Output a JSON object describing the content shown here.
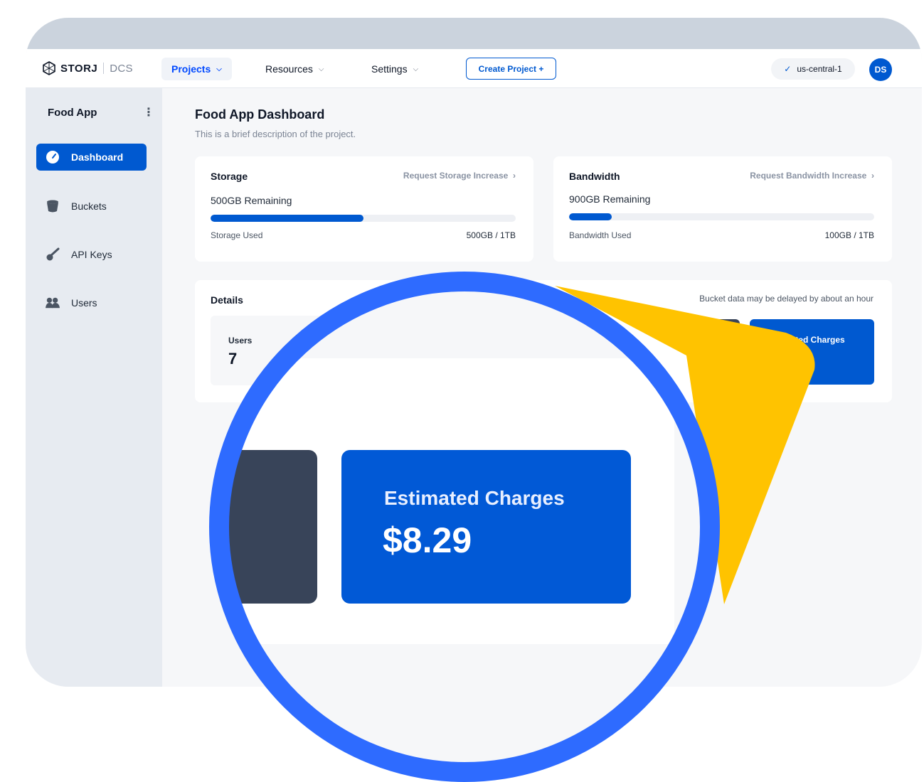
{
  "brand": {
    "name": "STORJ",
    "product": "DCS"
  },
  "topnav": {
    "items": [
      {
        "label": "Projects",
        "active": true
      },
      {
        "label": "Resources",
        "active": false
      },
      {
        "label": "Settings",
        "active": false
      }
    ],
    "create_project_label": "Create Project +",
    "region_label": "us-central-1",
    "avatar_initials": "DS"
  },
  "sidebar": {
    "project_name": "Food App",
    "items": [
      {
        "label": "Dashboard",
        "icon": "gauge-icon",
        "active": true
      },
      {
        "label": "Buckets",
        "icon": "bucket-icon",
        "active": false
      },
      {
        "label": "API Keys",
        "icon": "key-icon",
        "active": false
      },
      {
        "label": "Users",
        "icon": "users-icon",
        "active": false
      }
    ]
  },
  "page": {
    "title": "Food App Dashboard",
    "description": "This is a brief description of the project."
  },
  "storage": {
    "title": "Storage",
    "link": "Request Storage Increase",
    "remaining": "500GB Remaining",
    "used_label": "Storage Used",
    "used_value": "500GB / 1TB",
    "used_fraction": 0.5
  },
  "bandwidth": {
    "title": "Bandwidth",
    "link": "Request Bandwidth Increase",
    "remaining": "900GB Remaining",
    "used_label": "Bandwidth Used",
    "used_value": "100GB / 1TB",
    "used_fraction": 0.14
  },
  "details": {
    "title": "Details",
    "note": "Bucket data may be delayed by about an hour",
    "users_label": "Users",
    "users_value": "7",
    "charges_label": "Estimated Charges",
    "charges_value": "$8.29"
  },
  "colors": {
    "primary": "#0059d0",
    "lens_ring": "#2e6bff",
    "highlight": "#ffc300",
    "dark_tile": "#384459"
  }
}
